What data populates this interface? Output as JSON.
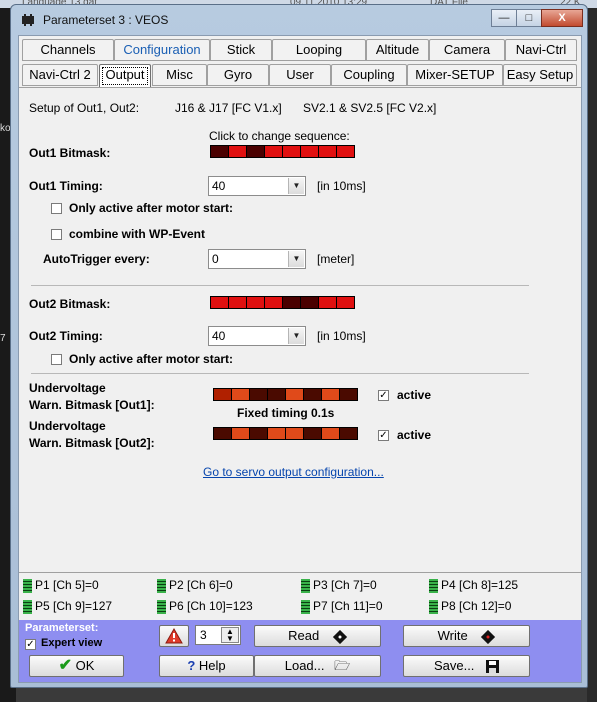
{
  "background": {
    "top_text_1": "Language 13.dat",
    "top_text_2": "09.11.2010 13:29",
    "top_text_3": "DAT File",
    "top_text_4": "22 K",
    "left_text_1": "ko",
    "left_text_2": "7"
  },
  "window": {
    "title": "Parameterset 3 : VEOS",
    "minimize": "—",
    "maximize": "□",
    "close": "X"
  },
  "tabs_row1": [
    "Channels",
    "Configuration",
    "Stick",
    "Looping",
    "Altitude",
    "Camera",
    "Navi-Ctrl"
  ],
  "tabs_row2": [
    "Navi-Ctrl 2",
    "Output",
    "Misc",
    "Gyro",
    "User",
    "Coupling",
    "Mixer-SETUP",
    "Easy Setup"
  ],
  "active_tab": "Output",
  "output": {
    "setup_label": "Setup of Out1, Out2:",
    "setup_fc1": "J16 & J17 [FC V1.x]",
    "setup_fc2": "SV2.1 & SV2.5 [FC V2.x]",
    "click_hint": "Click to change sequence:",
    "out1_bitmask_label": "Out1 Bitmask:",
    "out1_timing_label": "Out1 Timing:",
    "out1_timing_value": "40",
    "out1_timing_unit": "[in 10ms]",
    "out1_only_active": "Only active after motor start:",
    "combine_wp": "combine with WP-Event",
    "autotrigger_label": "AutoTrigger every:",
    "autotrigger_value": "0",
    "autotrigger_unit": "[meter]",
    "out2_bitmask_label": "Out2 Bitmask:",
    "out2_timing_label": "Out2 Timing:",
    "out2_timing_value": "40",
    "out2_timing_unit": "[in 10ms]",
    "out2_only_active": "Only active after motor start:",
    "uv1_label_line1": "Undervoltage",
    "uv1_label_line2": "Warn. Bitmask [Out1]:",
    "uv1_active": "active",
    "fixed_timing": "Fixed timing 0.1s",
    "uv2_label_line1": "Undervoltage",
    "uv2_label_line2": "Warn. Bitmask [Out2]:",
    "uv2_active": "active",
    "servo_link": "Go to servo output configuration..."
  },
  "bitmask_colors": {
    "out1": [
      "#4a0000",
      "#e01010",
      "#4a0000",
      "#e01010",
      "#e01010",
      "#e01010",
      "#e01010",
      "#e01010"
    ],
    "out2": [
      "#e01010",
      "#e01010",
      "#e01010",
      "#e01010",
      "#4a0000",
      "#4a0000",
      "#e01010",
      "#e01010"
    ],
    "uv1": [
      "#b02000",
      "#e04a1a",
      "#4a0a00",
      "#4a0a00",
      "#e04a1a",
      "#4a0a00",
      "#e04a1a",
      "#4a0a00"
    ],
    "uv2": [
      "#4a0a00",
      "#e04a1a",
      "#4a0a00",
      "#e04a1a",
      "#e04a1a",
      "#4a0a00",
      "#e04a1a",
      "#4a0a00"
    ]
  },
  "channels": [
    "P1 [Ch 5]=0",
    "P2 [Ch 6]=0",
    "P3 [Ch 7]=0",
    "P4 [Ch 8]=125",
    "P5 [Ch 9]=127",
    "P6 [Ch 10]=123",
    "P7 [Ch 11]=0",
    "P8 [Ch 12]=0"
  ],
  "bottom": {
    "parameterset_label": "Parameterset:",
    "expert_view": "Expert view",
    "spin_value": "3",
    "read": "Read",
    "write": "Write",
    "ok": "OK",
    "help": "Help",
    "load": "Load...",
    "save": "Save..."
  }
}
